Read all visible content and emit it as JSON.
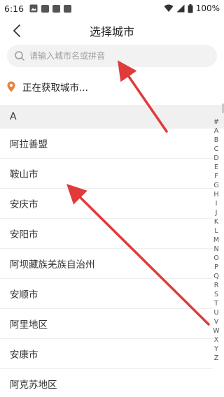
{
  "status_bar": {
    "time": "6:16",
    "battery": "100%"
  },
  "nav": {
    "title": "选择城市"
  },
  "search": {
    "placeholder": "请输入城市名或拼音",
    "value": ""
  },
  "location": {
    "status_text": "正在获取城市..."
  },
  "section": {
    "letter": "A"
  },
  "cities": [
    "阿拉善盟",
    "鞍山市",
    "安庆市",
    "安阳市",
    "阿坝藏族羌族自治州",
    "安顺市",
    "阿里地区",
    "安康市",
    "阿克苏地区"
  ],
  "alphabet_index": [
    "#",
    "A",
    "B",
    "C",
    "D",
    "E",
    "F",
    "G",
    "H",
    "I",
    "J",
    "K",
    "L",
    "M",
    "N",
    "O",
    "P",
    "Q",
    "R",
    "S",
    "T",
    "U",
    "V",
    "W",
    "X",
    "Y",
    "Z"
  ],
  "colors": {
    "accent_pin": "#e8833a",
    "annotation_arrow": "#e03a3a",
    "search_bg": "#f2f2f2",
    "section_bg": "#f0f0f0"
  }
}
